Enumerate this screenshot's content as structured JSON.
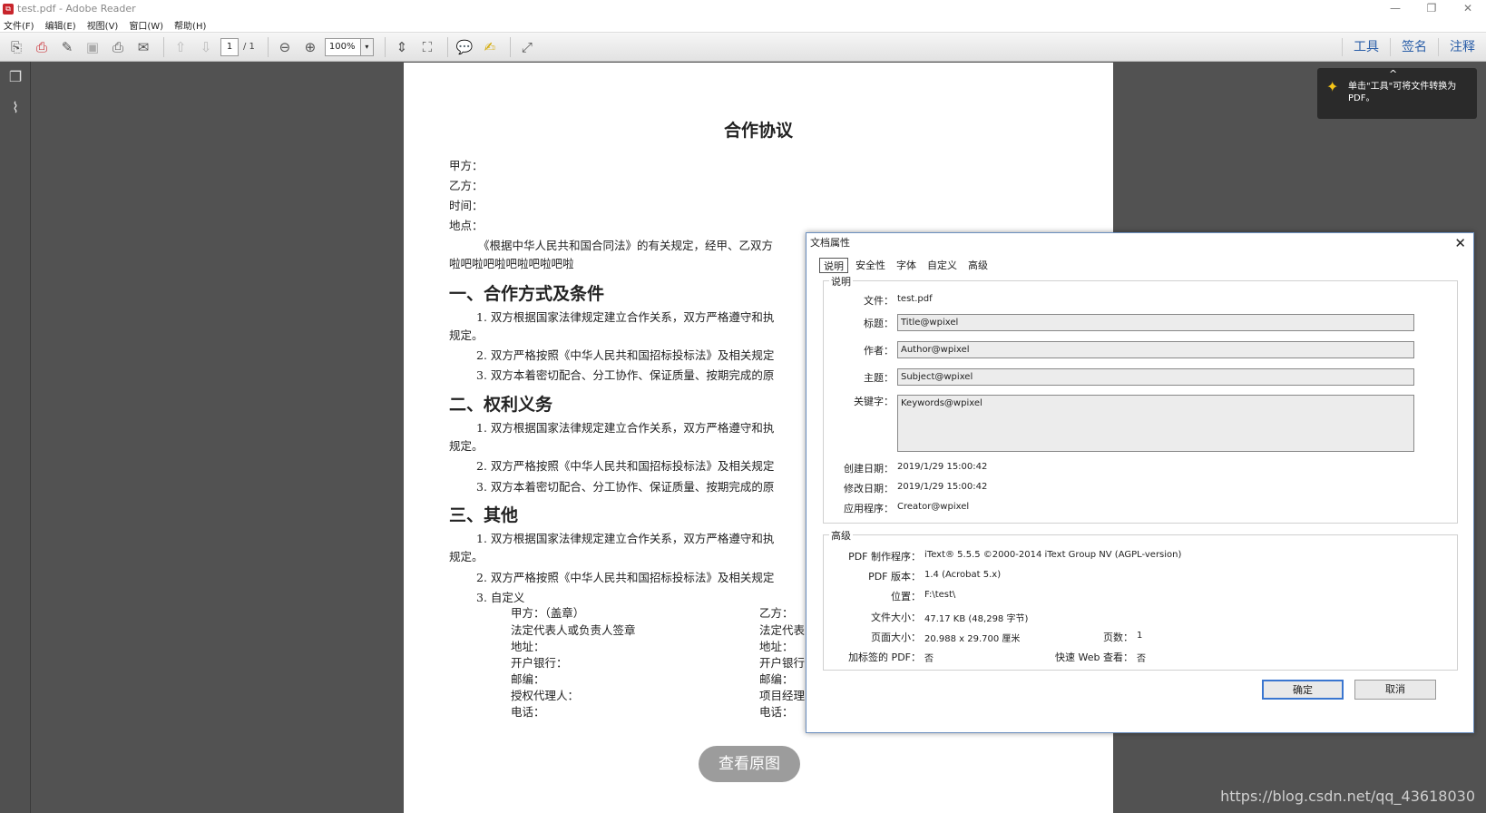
{
  "window": {
    "title": "test.pdf - Adobe Reader",
    "min": "—",
    "restore": "❐",
    "close": "✕"
  },
  "menu": [
    "文件(F)",
    "编辑(E)",
    "视图(V)",
    "窗口(W)",
    "帮助(H)"
  ],
  "toolbar": {
    "page_current": "1",
    "page_total": "/ 1",
    "zoom": "100%",
    "zoom_drop": "▾"
  },
  "right_tools": {
    "tools": "工具",
    "sign": "签名",
    "comment": "注释"
  },
  "tip": {
    "caret": "^",
    "text": "单击\"工具\"可将文件转换为PDF。"
  },
  "document": {
    "title": "合作协议",
    "party_a": "甲方：",
    "party_b": "乙方：",
    "time": "时间：",
    "place": "地点：",
    "intro_1": "《根据中华人民共和国合同法》的有关规定，经甲、乙双方",
    "intro_2": "啦吧啦吧啦吧啦吧啦吧啦",
    "sec1": "一、合作方式及条件",
    "s1_1": "1. 双方根据国家法律规定建立合作关系，双方严格遵守和执",
    "s1_1b": "规定。",
    "s1_2": "2. 双方严格按照《中华人民共和国招标投标法》及相关规定",
    "s1_3": "3. 双方本着密切配合、分工协作、保证质量、按期完成的原",
    "sec2": "二、权利义务",
    "s2_1": "1. 双方根据国家法律规定建立合作关系，双方严格遵守和执",
    "s2_1b": "规定。",
    "s2_2": "2. 双方严格按照《中华人民共和国招标投标法》及相关规定",
    "s2_3": "3. 双方本着密切配合、分工协作、保证质量、按期完成的原",
    "sec3": "三、其他",
    "s3_1": "1. 双方根据国家法律规定建立合作关系，双方严格遵守和执",
    "s3_1b": "规定。",
    "s3_2": "2. 双方严格按照《中华人民共和国招标投标法》及相关规定",
    "s3_3": "3. 自定义",
    "sig_a": [
      "甲方：（盖章）",
      "法定代表人或负责人签章",
      "地址：",
      "开户银行：",
      "邮编：",
      "授权代理人：",
      "电话："
    ],
    "sig_b": [
      "乙方：",
      "法定代表",
      "地址：",
      "开户银行",
      "邮编：",
      "项目经理",
      "电话："
    ]
  },
  "view_original": "查看原图",
  "watermark": "https://blog.csdn.net/qq_43618030",
  "dialog": {
    "title": "文档属性",
    "close": "✕",
    "tabs": [
      "说明",
      "安全性",
      "字体",
      "自定义",
      "高级"
    ],
    "desc_group": "说明",
    "file_label": "文件：",
    "file_value": "test.pdf",
    "title_label": "标题：",
    "title_value": "Title@wpixel",
    "author_label": "作者：",
    "author_value": "Author@wpixel",
    "subject_label": "主题：",
    "subject_value": "Subject@wpixel",
    "keywords_label": "关键字：",
    "keywords_value": "Keywords@wpixel",
    "created_label": "创建日期：",
    "created_value": "2019/1/29 15:00:42",
    "modified_label": "修改日期：",
    "modified_value": "2019/1/29 15:00:42",
    "app_label": "应用程序：",
    "app_value": "Creator@wpixel",
    "adv_group": "高级",
    "producer_label": "PDF 制作程序：",
    "producer_value": "iText® 5.5.5 ©2000-2014 iText Group NV (AGPL-version)",
    "version_label": "PDF 版本：",
    "version_value": "1.4 (Acrobat 5.x)",
    "location_label": "位置：",
    "location_value": "F:\\test\\",
    "size_label": "文件大小：",
    "size_value": "47.17 KB (48,298 字节)",
    "pagesize_label": "页面大小：",
    "pagesize_value": "20.988 x 29.700 厘米",
    "pages_label": "页数：",
    "pages_value": "1",
    "tagged_label": "加标签的 PDF：",
    "tagged_value": "否",
    "fastweb_label": "快速 Web 查看：",
    "fastweb_value": "否",
    "ok": "确定",
    "cancel": "取消"
  }
}
